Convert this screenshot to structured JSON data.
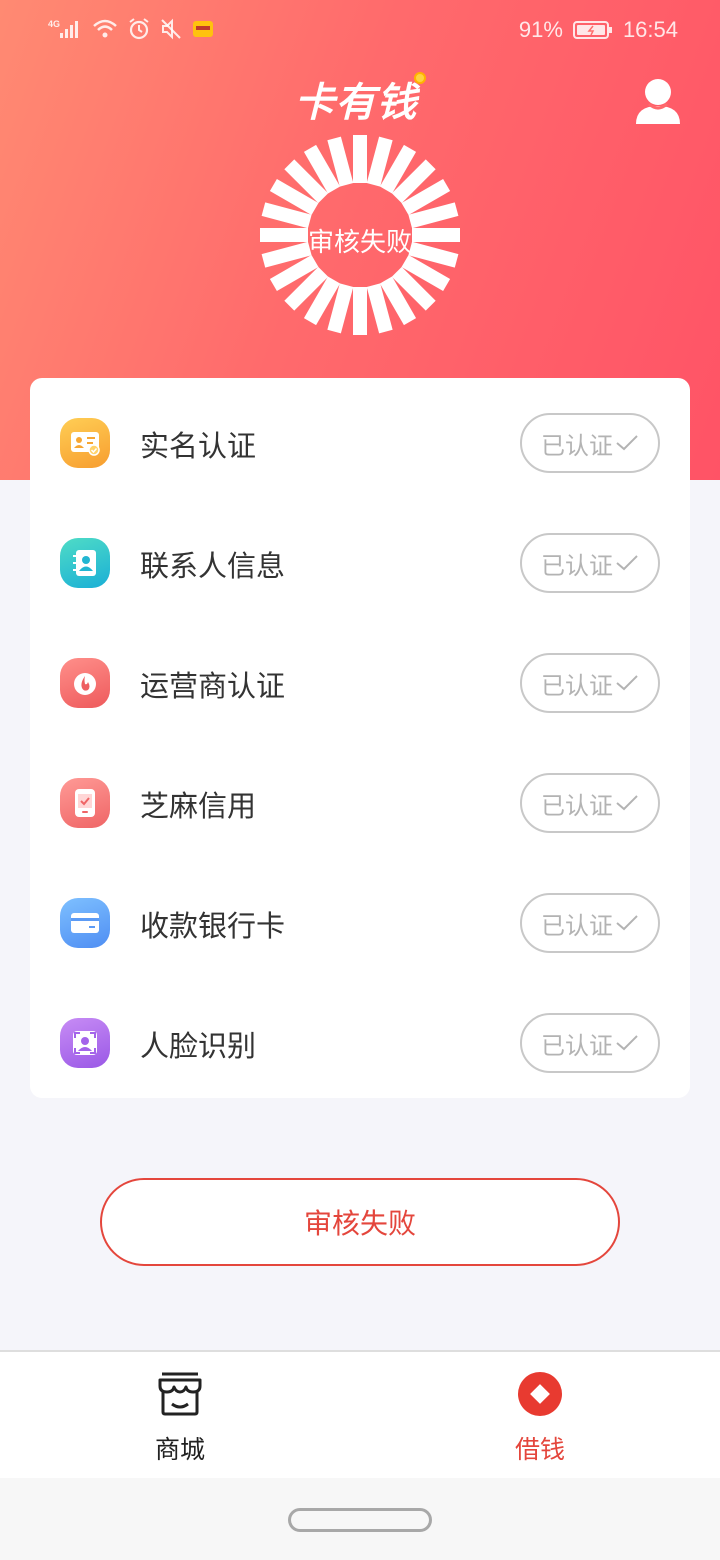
{
  "statusbar": {
    "network": "4G",
    "battery": "91%",
    "time": "16:54"
  },
  "header": {
    "logo": "卡有钱",
    "status_text": "审核失败"
  },
  "verification": {
    "items": [
      {
        "label": "实名认证",
        "status": "已认证",
        "icon": "id-card-icon",
        "color_from": "#ffce55",
        "color_to": "#f79d2f"
      },
      {
        "label": "联系人信息",
        "status": "已认证",
        "icon": "contact-book-icon",
        "color_from": "#4fdcc6",
        "color_to": "#1aafd6"
      },
      {
        "label": "运营商认证",
        "status": "已认证",
        "icon": "carrier-icon",
        "color_from": "#ff8f8a",
        "color_to": "#ee5a5c"
      },
      {
        "label": "芝麻信用",
        "status": "已认证",
        "icon": "credit-phone-icon",
        "color_from": "#ff9a96",
        "color_to": "#ef6566"
      },
      {
        "label": "收款银行卡",
        "status": "已认证",
        "icon": "bank-card-icon",
        "color_from": "#7ec0ff",
        "color_to": "#4f8ef3"
      },
      {
        "label": "人脸识别",
        "status": "已认证",
        "icon": "face-scan-icon",
        "color_from": "#c78cf5",
        "color_to": "#9a58e6"
      }
    ]
  },
  "action": {
    "label": "审核失败"
  },
  "tabbar": {
    "shop": {
      "label": "商城",
      "icon": "store-icon"
    },
    "borrow": {
      "label": "借钱",
      "icon": "borrow-icon"
    }
  },
  "colors": {
    "accent": "#e4463c",
    "header_start": "#ff8a72",
    "header_end": "#ff5366"
  }
}
